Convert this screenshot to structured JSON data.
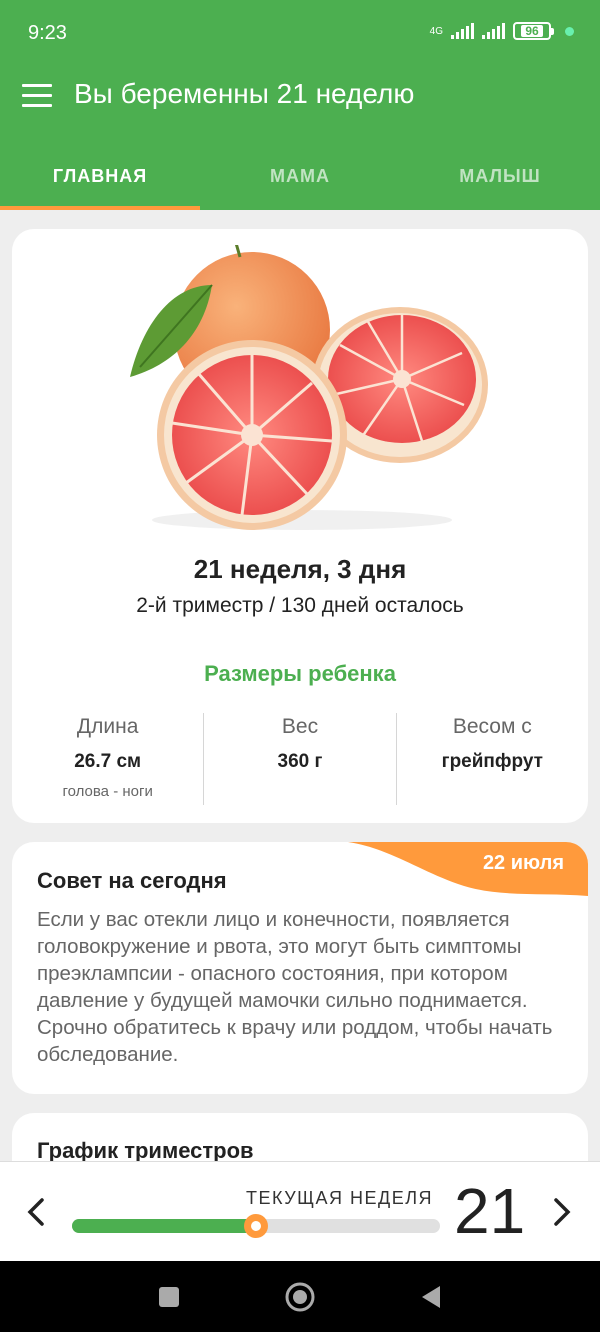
{
  "status_bar": {
    "time": "9:23",
    "network": "4G",
    "battery": "96"
  },
  "app_bar": {
    "title": "Вы беременны 21 неделю"
  },
  "tabs": [
    {
      "label": "ГЛАВНАЯ",
      "active": true
    },
    {
      "label": "МАМА",
      "active": false
    },
    {
      "label": "МАЛЫШ",
      "active": false
    }
  ],
  "summary": {
    "week_days": "21 неделя, 3 дня",
    "trimester": "2-й триместр / 130 дней осталось",
    "sizes_title": "Размеры ребенка",
    "stats": [
      {
        "label": "Длина",
        "value": "26.7 см",
        "sub": "голова - ноги"
      },
      {
        "label": "Вес",
        "value": "360 г",
        "sub": ""
      },
      {
        "label": "Весом с",
        "value": "грейпфрут",
        "sub": ""
      }
    ]
  },
  "tip": {
    "date": "22 июля",
    "title": "Совет на сегодня",
    "text": "Если у вас отекли лицо и конечности, появляется головокружение и рвота, это могут быть симптомы преэклампсии - опасного состояния, при котором давление у будущей мамочки сильно поднимается. Срочно обратитесь к врачу или роддом, чтобы начать обследование."
  },
  "trimester_chart": {
    "title": "График триместров"
  },
  "week_selector": {
    "label": "ТЕКУЩАЯ НЕДЕЛЯ",
    "current_week": "21",
    "progress": 0.5
  },
  "colors": {
    "primary": "#4caf50",
    "accent": "#ff9a3c"
  },
  "icons": [
    "menu-icon",
    "chevron-left-icon",
    "chevron-right-icon",
    "home-icon",
    "back-icon",
    "recents-icon"
  ]
}
